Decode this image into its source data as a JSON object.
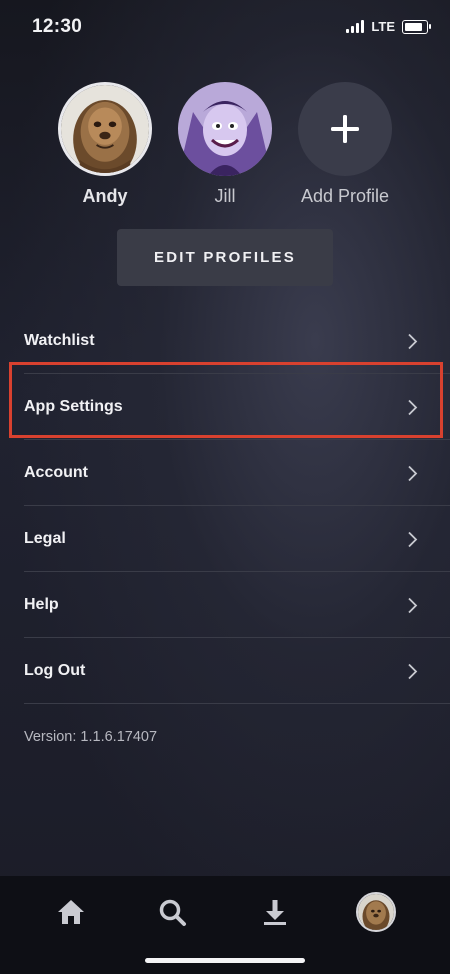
{
  "status_bar": {
    "time": "12:30",
    "network": "LTE"
  },
  "profiles": [
    {
      "name": "Andy",
      "avatar_icon": "chewbacca-avatar-icon",
      "selected": true
    },
    {
      "name": "Jill",
      "avatar_icon": "yzma-avatar-icon",
      "selected": false
    },
    {
      "name": "Add Profile",
      "avatar_icon": "plus-icon",
      "selected": false
    }
  ],
  "edit_profiles_label": "EDIT PROFILES",
  "menu": {
    "items": [
      {
        "label": "Watchlist"
      },
      {
        "label": "App Settings",
        "highlighted": true
      },
      {
        "label": "Account"
      },
      {
        "label": "Legal"
      },
      {
        "label": "Help"
      },
      {
        "label": "Log Out"
      }
    ]
  },
  "version": "Version: 1.1.6.17407",
  "tab_bar": {
    "tabs": [
      {
        "icon": "home-icon"
      },
      {
        "icon": "search-icon"
      },
      {
        "icon": "download-icon"
      },
      {
        "icon": "profile-avatar-icon",
        "active": true
      }
    ]
  },
  "colors": {
    "highlight": "#d8412f",
    "background": "#1b1c27",
    "button": "#3a3c47"
  }
}
